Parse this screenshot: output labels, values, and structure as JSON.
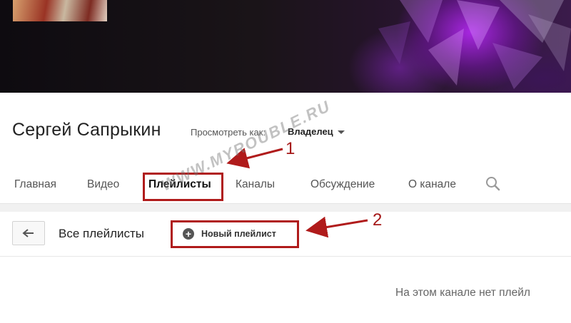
{
  "channel": {
    "name": "Сергей Сапрыкин",
    "view_as_label": "Просмотреть как:",
    "view_as_value": "Владелец"
  },
  "tabs": [
    {
      "label": "Главная",
      "active": false
    },
    {
      "label": "Видео",
      "active": false
    },
    {
      "label": "Плейлисты",
      "active": true
    },
    {
      "label": "Каналы",
      "active": false
    },
    {
      "label": "Обсуждение",
      "active": false
    },
    {
      "label": "О канале",
      "active": false
    }
  ],
  "playlists_bar": {
    "title": "Все плейлисты",
    "new_playlist_label": "Новый плейлист"
  },
  "empty_message": "На этом канале нет плейл",
  "annotations": {
    "marker_1": "1",
    "marker_2": "2",
    "watermark": "WWW.MYROUBLE.RU",
    "color": "#b01b1b"
  },
  "icons": {
    "back": "back-arrow-icon",
    "search": "search-icon",
    "add": "plus-circle-icon",
    "dropdown": "caret-down-icon"
  }
}
